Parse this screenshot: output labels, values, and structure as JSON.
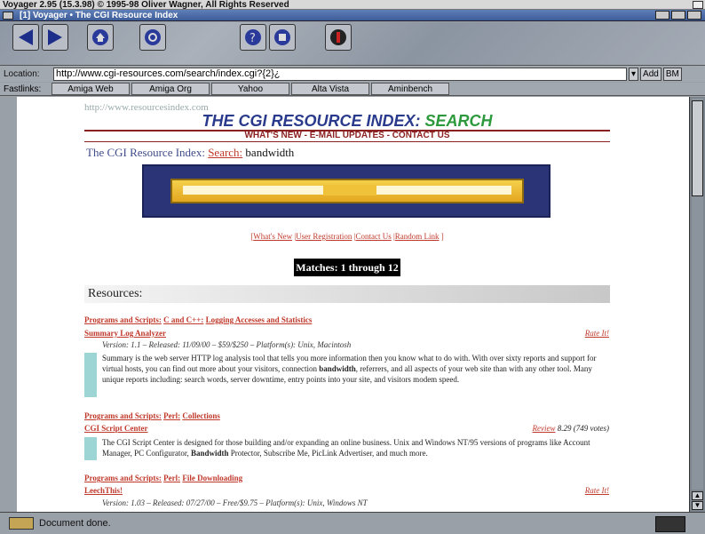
{
  "screen_title": "Voyager 2.95 (15.3.98) © 1995-98 Oliver Wagner, All Rights Reserved",
  "window_title": "[1] Voyager • The CGI Resource Index",
  "toolbar": {
    "buttons": [
      "back-arrow-icon",
      "forward-arrow-icon",
      "home-icon",
      "reload-icon",
      "search-icon",
      "hotlist-icon",
      "stop-icon"
    ]
  },
  "location": {
    "label": "Location:",
    "url": "http://www.cgi-resources.com/search/index.cgi?{2}¿",
    "add_label": "Add",
    "bm_label": "BM"
  },
  "fastlinks": {
    "label": "Fastlinks:",
    "items": [
      "Amiga Web",
      "Amiga Org",
      "Yahoo",
      "Alta Vista",
      "Aminbench"
    ]
  },
  "page": {
    "site_url": "http://www.resourcesindex.com",
    "title_main": "THE CGI RESOURCE INDEX:",
    "title_accent": "SEARCH",
    "nav_links": "WHAT'S NEW - E-MAIL UPDATES - CONTACT US",
    "breadcrumb_prefix": "The CGI Resource Index:",
    "breadcrumb_link": "Search:",
    "search_term": "bandwidth",
    "links_line": [
      "What's New",
      "User Registration",
      "Contact Us",
      "Random Link"
    ],
    "matches": "Matches: 1 through 12",
    "resources_heading": "Resources:",
    "entries": [
      {
        "category": [
          "Programs and Scripts:",
          "C and C++:",
          "Logging Accesses and Statistics"
        ],
        "title": "Summary Log Analyzer",
        "right": "Rate It!",
        "meta": "Version: 1.1 – Released: 11/09/00 – $59/$250 – Platform(s): Unix, Macintosh",
        "desc_before": "Summary is the web server HTTP log analysis tool that tells you more information then you know what to do with. With over sixty reports and support for virtual hosts, you can find out more about your visitors, connection ",
        "desc_bold": "bandwidth",
        "desc_after": ", referrers, and all aspects of your web site than with any other tool. Many unique reports including: search words, server downtime, entry points into your site, and visitors modem speed."
      },
      {
        "category": [
          "Programs and Scripts:",
          "Perl:",
          "Collections"
        ],
        "title": "CGI Script Center",
        "right": "Review",
        "right_extra": "8.29 (749 votes)",
        "desc_before": "The CGI Script Center is designed for those building and/or expanding an online business. Unix and Windows NT/95 versions of programs like Account Manager, PC Configurator, ",
        "desc_bold": "Bandwidth",
        "desc_after": " Protector, Subscribe Me, PicLink Advertiser, and much more."
      },
      {
        "category": [
          "Programs and Scripts:",
          "Perl:",
          "File Downloading"
        ],
        "title": "LeechThis!",
        "right": "Rate It!",
        "meta": "Version: 1.03 – Released: 07/27/00 – Free/$9.75 – Platform(s): Unix, Windows NT"
      }
    ]
  },
  "status": {
    "text": "Document done."
  }
}
